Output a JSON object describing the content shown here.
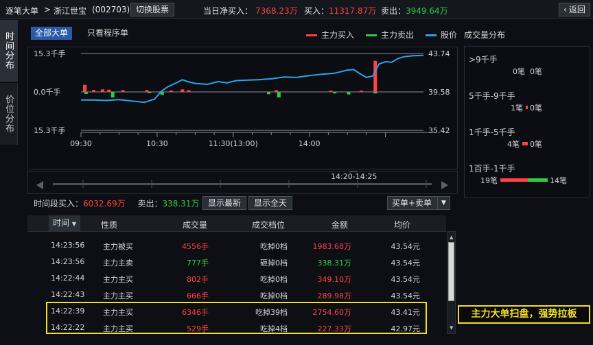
{
  "header": {
    "title": "逐笔大单",
    "crumb_sep": ">",
    "stock_name": "浙江世宝",
    "stock_code": "(002703)",
    "switch_button": "切换股票",
    "net_buy_label": "当日净买入：",
    "net_buy_value": "7368.23万",
    "buy_label": "买入：",
    "buy_value": "11317.87万",
    "sell_label": "卖出：",
    "sell_value": "3949.64万",
    "back_button": "返回"
  },
  "side_tabs": [
    {
      "label": "时间分布",
      "active": true
    },
    {
      "label": "价位分布",
      "active": false
    }
  ],
  "filters": {
    "all_big": "全部大单",
    "program_only": "只看程序单"
  },
  "legend": {
    "buy": "主力买入",
    "sell": "主力卖出",
    "price": "股价",
    "title": "成交量分布"
  },
  "colors": {
    "buy": "#ff4242",
    "sell": "#2ecc40",
    "price": "#2aa5ea",
    "highlight": "#f3df2a",
    "accent": "#2b5ba8"
  },
  "chart_data": {
    "type": "bar",
    "y_left_ticks": [
      "15.3千手",
      "0.0千手",
      "15.3千手"
    ],
    "y_right_ticks": [
      "43.74",
      "39.58",
      "35.42"
    ],
    "x_ticks": [
      "09:30",
      "10:30",
      "11:30(13:00)",
      "14:00"
    ],
    "price_range": [
      35.42,
      43.74
    ],
    "volume_range": [
      -15.3,
      15.3
    ],
    "price_series": {
      "name": "股价",
      "points": [
        [
          0,
          38.7
        ],
        [
          10,
          38.7
        ],
        [
          20,
          38.65
        ],
        [
          30,
          38.75
        ],
        [
          40,
          38.6
        ],
        [
          50,
          38.45
        ],
        [
          58,
          38.8
        ],
        [
          63,
          39.6
        ],
        [
          68,
          40.1
        ],
        [
          75,
          40.55
        ],
        [
          80,
          40.9
        ],
        [
          84,
          40.7
        ],
        [
          90,
          40.5
        ],
        [
          100,
          40.4
        ],
        [
          108,
          40.7
        ],
        [
          115,
          40.55
        ],
        [
          122,
          40.8
        ],
        [
          130,
          40.85
        ],
        [
          140,
          40.9
        ],
        [
          150,
          41.0
        ],
        [
          160,
          41.2
        ],
        [
          170,
          41.15
        ],
        [
          180,
          41.35
        ],
        [
          190,
          41.5
        ],
        [
          200,
          41.6
        ],
        [
          210,
          41.95
        ],
        [
          215,
          42.0
        ],
        [
          220,
          41.55
        ],
        [
          225,
          41.15
        ],
        [
          230,
          41.3
        ],
        [
          235,
          42.6
        ],
        [
          240,
          42.85
        ],
        [
          245,
          42.8
        ],
        [
          250,
          43.2
        ],
        [
          255,
          43.4
        ],
        [
          262,
          43.5
        ],
        [
          270,
          43.54
        ]
      ]
    },
    "buy_bars": [
      [
        3,
        2.8
      ],
      [
        10,
        0.8
      ],
      [
        17,
        1.0
      ],
      [
        22,
        0.9
      ],
      [
        33,
        0.7
      ],
      [
        52,
        0.7
      ],
      [
        71,
        0.6
      ],
      [
        80,
        1.0
      ],
      [
        85,
        0.7
      ],
      [
        154,
        0.7
      ],
      [
        197,
        0.5
      ],
      [
        221,
        0.5
      ],
      [
        232,
        12.4
      ]
    ],
    "sell_bars": [
      [
        4,
        -0.8
      ],
      [
        25,
        -2.2
      ],
      [
        54,
        -0.5
      ],
      [
        64,
        -1.2
      ],
      [
        148,
        -0.9
      ],
      [
        156,
        -2.2
      ],
      [
        200,
        -0.6
      ],
      [
        211,
        -1.0
      ],
      [
        232,
        -0.6
      ]
    ]
  },
  "range_label": "14:20-14:25",
  "stats": {
    "period_buy_label": "时间段买入：",
    "period_buy_value": "6032.69万",
    "period_sell_label": "卖出：",
    "period_sell_value": "338.31万",
    "show_latest": "显示最新",
    "show_all": "显示全天",
    "dropdown_value": "买单+卖单"
  },
  "table": {
    "columns": [
      "时间",
      "性质",
      "成交量",
      "成交档位",
      "金额",
      "均价"
    ],
    "rows": [
      {
        "time": "14:23:56",
        "type": "主力被买",
        "volume": "4556手",
        "level": "吃掉0档",
        "amount": "1983.68万",
        "avg": "43.54元",
        "color": "red"
      },
      {
        "time": "14:23:56",
        "type": "主力主卖",
        "volume": "777手",
        "level": "砸掉0档",
        "amount": "338.31万",
        "avg": "43.54元",
        "color": "green"
      },
      {
        "time": "14:22:44",
        "type": "主力主买",
        "volume": "802手",
        "level": "吃掉0档",
        "amount": "349.10万",
        "avg": "43.54元",
        "color": "red"
      },
      {
        "time": "14:22:43",
        "type": "主力主买",
        "volume": "666手",
        "level": "吃掉0档",
        "amount": "289.98万",
        "avg": "43.54元",
        "color": "red"
      },
      {
        "time": "14:22:39",
        "type": "主力主买",
        "volume": "6346手",
        "level": "吃掉39档",
        "amount": "2754.60万",
        "avg": "43.41元",
        "color": "red"
      },
      {
        "time": "14:22:22",
        "type": "主力主买",
        "volume": "529手",
        "level": "吃掉4档",
        "amount": "227.33万",
        "avg": "42.97元",
        "color": "red"
      }
    ]
  },
  "callout": "主力大单扫盘，强势拉板",
  "size_dist": [
    {
      "label": ">9千手",
      "buy": "0笔",
      "sell": "0笔",
      "buy_n": 0,
      "sell_n": 0
    },
    {
      "label": "5千手-9千手",
      "buy": "1笔",
      "sell": "0笔",
      "buy_n": 1,
      "sell_n": 0
    },
    {
      "label": "1千手-5千手",
      "buy": "4笔",
      "sell": "0笔",
      "buy_n": 4,
      "sell_n": 0
    },
    {
      "label": "1百手-1千手",
      "buy": "19笔",
      "sell": "14笔",
      "buy_n": 19,
      "sell_n": 14
    }
  ]
}
